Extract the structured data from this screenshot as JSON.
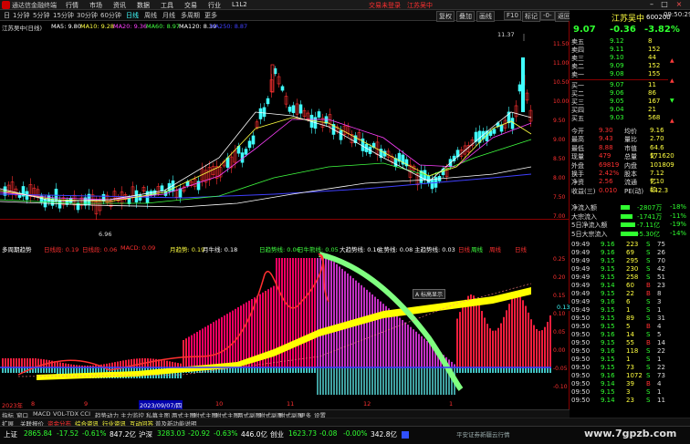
{
  "app": {
    "title": "通达信金融终端",
    "menu": [
      "行情",
      "市场",
      "资讯",
      "数据",
      "工具",
      "交易",
      "行业",
      "L1L2"
    ],
    "menu_red": [
      "交易未登录",
      "江苏吴中"
    ],
    "watermark": "www.7gpzb.com"
  },
  "toolbar": {
    "items": [
      "日",
      "1分钟",
      "5分钟",
      "15分钟",
      "30分钟",
      "60分钟",
      "日线",
      "周线",
      "月线",
      "多周期",
      "更多"
    ],
    "active": "日线",
    "right": [
      "复权",
      "叠加",
      "画线",
      "F10",
      "标记",
      "-0-",
      "返回"
    ]
  },
  "chart1": {
    "stock_label": "江苏吴中(日线)",
    "ma_legend": [
      {
        "text": "MA5: 9.80",
        "color": "#ffffff"
      },
      {
        "text": "MA10: 9.28",
        "color": "#ffff40"
      },
      {
        "text": "MA20: 9.36",
        "color": "#ff40ff"
      },
      {
        "text": "MA60: 8.97",
        "color": "#40ff40"
      },
      {
        "text": "MA120: 8.39",
        "color": "#ffffff"
      },
      {
        "text": "MA250: 8.87",
        "color": "#4040ff"
      }
    ],
    "high_label": "11.37",
    "low_label": "6.96",
    "price_ticks": [
      "11.50",
      "11.00",
      "10.50",
      "10.00",
      "9.50",
      "9.00",
      "8.50",
      "8.00",
      "7.50",
      "7.00"
    ]
  },
  "chart2": {
    "legend": [
      {
        "text": "多周期趋势",
        "color": "#ffffff"
      },
      {
        "text": "日线段: 0.19",
        "color": "#ff3030"
      },
      {
        "text": "日线段: 0.06",
        "color": "#ff3030"
      },
      {
        "text": "MACD: 0.09",
        "color": "#ff3030"
      },
      {
        "text": "月趋势: 0.19",
        "color": "#ffff40"
      },
      {
        "text": "月牛线: 0.18",
        "color": "#ffffff"
      },
      {
        "text": "日趋势线: 0.06",
        "color": "#40ff40"
      },
      {
        "text": "日牛熊线: 0.05",
        "color": "#40ff40"
      },
      {
        "text": "大趋势线: 0.16",
        "color": "#ffffff"
      },
      {
        "text": "主势线: 0.08",
        "color": "#ffffff"
      },
      {
        "text": "主趋势线: 0.03",
        "color": "#ffffff"
      },
      {
        "text": "日线",
        "color": "#ff3030"
      },
      {
        "text": "周线",
        "color": "#40ff40"
      },
      {
        "text": "周线",
        "color": "#ff3030"
      },
      {
        "text": "日线",
        "color": "#ff3030"
      }
    ],
    "ticks": [
      "0.25",
      "0.20",
      "0.15",
      "0.10",
      "0.05",
      "0.00",
      "-0.05",
      "-0.10"
    ],
    "tooltip": "A 标高显示",
    "right_value": "0.13"
  },
  "dates": {
    "year": "2023年",
    "m8": "8",
    "m9": "9",
    "selected": "2023/09/07/四",
    "m10": "10",
    "m11": "11",
    "m12": "12",
    "m1": "1"
  },
  "quote": {
    "name": "江苏吴中",
    "code": "600200",
    "price": "9.07",
    "change": "-0.36",
    "pct": "-3.82%",
    "asks": [
      {
        "label": "卖五",
        "price": "9.12",
        "vol": "8"
      },
      {
        "label": "卖四",
        "price": "9.11",
        "vol": "152"
      },
      {
        "label": "卖三",
        "price": "9.10",
        "vol": "44"
      },
      {
        "label": "卖二",
        "price": "9.09",
        "vol": "152"
      },
      {
        "label": "卖一",
        "price": "9.08",
        "vol": "155"
      }
    ],
    "bids": [
      {
        "label": "买一",
        "price": "9.07",
        "vol": "11"
      },
      {
        "label": "买二",
        "price": "9.06",
        "vol": "86"
      },
      {
        "label": "买三",
        "price": "9.05",
        "vol": "167"
      },
      {
        "label": "买四",
        "price": "9.04",
        "vol": "21"
      },
      {
        "label": "买五",
        "price": "9.03",
        "vol": "568"
      }
    ],
    "stats": [
      {
        "l1": "今开",
        "v1": "9.30",
        "l2": "均价",
        "v2": "9.16"
      },
      {
        "l1": "最高",
        "v1": "9.43",
        "l2": "量比",
        "v2": "2.70"
      },
      {
        "l1": "最低",
        "v1": "8.88",
        "l2": "市值",
        "v2": "64.6亿"
      },
      {
        "l1": "现量",
        "v1": "479",
        "l2": "总量",
        "v2": "171620"
      },
      {
        "l1": "外盘",
        "v1": "69819",
        "l2": "内盘",
        "v2": "101809"
      },
      {
        "l1": "换手",
        "v1": "2.42%",
        "l2": "股本",
        "v2": "7.12亿"
      },
      {
        "l1": "净资",
        "v1": "2.56",
        "l2": "流通",
        "v2": "7.10亿"
      },
      {
        "l1": "收益(三)",
        "v1": "0.010",
        "l2": "PE(动)",
        "v2": "442.3"
      }
    ],
    "flows": [
      {
        "label": "净流入额",
        "v1": "-2807万",
        "v2": "-18%"
      },
      {
        "label": "大宗流入",
        "v1": "-1741万",
        "v2": "-11%"
      },
      {
        "label": "5日净流入额",
        "v1": "-7.11亿",
        "v2": "-19%"
      },
      {
        "label": "5日大宗流入",
        "v1": "-5.30亿",
        "v2": "-14%"
      }
    ],
    "ticks": [
      {
        "t": "09:49",
        "p": "9.16",
        "v": "223",
        "s": "S",
        "n": "75"
      },
      {
        "t": "09:49",
        "p": "9.16",
        "v": "69",
        "s": "S",
        "n": "26"
      },
      {
        "t": "09:49",
        "p": "9.15",
        "v": "295",
        "s": "S",
        "n": "70"
      },
      {
        "t": "09:49",
        "p": "9.15",
        "v": "230",
        "s": "S",
        "n": "42"
      },
      {
        "t": "09:49",
        "p": "9.15",
        "v": "258",
        "s": "S",
        "n": "51"
      },
      {
        "t": "09:49",
        "p": "9.14",
        "v": "60",
        "s": "B",
        "n": "23"
      },
      {
        "t": "09:49",
        "p": "9.15",
        "v": "22",
        "s": "B",
        "n": "8"
      },
      {
        "t": "09:49",
        "p": "9.16",
        "v": "6",
        "s": "S",
        "n": "3"
      },
      {
        "t": "09:49",
        "p": "9.15",
        "v": "1",
        "s": "S",
        "n": "1"
      },
      {
        "t": "09:50",
        "p": "9.15",
        "v": "89",
        "s": "S",
        "n": "31"
      },
      {
        "t": "09:50",
        "p": "9.15",
        "v": "5",
        "s": "B",
        "n": "4"
      },
      {
        "t": "09:50",
        "p": "9.16",
        "v": "14",
        "s": "S",
        "n": "5"
      },
      {
        "t": "09:50",
        "p": "9.15",
        "v": "55",
        "s": "B",
        "n": "14"
      },
      {
        "t": "09:50",
        "p": "9.16",
        "v": "118",
        "s": "S",
        "n": "22"
      },
      {
        "t": "09:50",
        "p": "9.15",
        "v": "1",
        "s": "S",
        "n": "1"
      },
      {
        "t": "09:50",
        "p": "9.15",
        "v": "73",
        "s": "S",
        "n": "22"
      },
      {
        "t": "09:50",
        "p": "9.16",
        "v": "1072",
        "s": "S",
        "n": "73"
      },
      {
        "t": "09:50",
        "p": "9.14",
        "v": "39",
        "s": "B",
        "n": "4"
      },
      {
        "t": "09:50",
        "p": "9.15",
        "v": "3",
        "s": "S",
        "n": "1"
      },
      {
        "t": "09:50",
        "p": "9.14",
        "v": "23",
        "s": "S",
        "n": "11"
      }
    ],
    "bottom_tabs": [
      "笔",
      "价",
      "细",
      "势",
      "联",
      "值",
      "主",
      "筹"
    ]
  },
  "tabs": [
    "指标",
    "窗口",
    "MACD",
    "VOL-TDX",
    "CCI",
    "趋势动力",
    "主力监控",
    "私募主图",
    "两式主图",
    "附式主图",
    "附式主图",
    "两式副图",
    "附式副图",
    "附式副图",
    "更多",
    "设置"
  ],
  "tabs2": [
    "扩展",
    "关联报价",
    "资金分布",
    "综合资讯",
    "行业资讯",
    "互动问答",
    "普及新功能说明"
  ],
  "status": {
    "items": [
      {
        "label": "上证",
        "v": "2865.84",
        "c": "-17.52",
        "p": "-0.61%",
        "a": "847.2亿"
      },
      {
        "label": "沪深",
        "v": "3283.03",
        "c": "-20.92",
        "p": "-0.63%",
        "a": "446.0亿"
      },
      {
        "label": "创业",
        "v": "1623.73",
        "c": "-0.08",
        "p": "-0.00%",
        "a": "342.8亿"
      }
    ],
    "right": "平安证券新疆云行情",
    "time": "09:50:29"
  }
}
